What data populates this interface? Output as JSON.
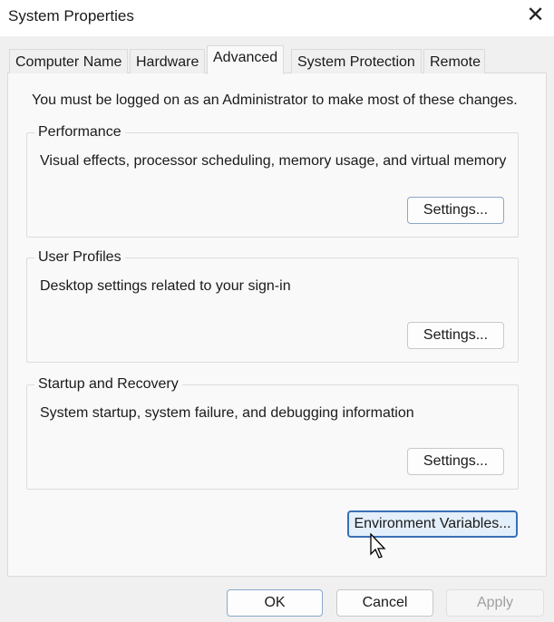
{
  "window": {
    "title": "System Properties",
    "close_icon": "close-icon"
  },
  "tabs": [
    {
      "label": "Computer Name"
    },
    {
      "label": "Hardware"
    },
    {
      "label": "Advanced",
      "active": true
    },
    {
      "label": "System Protection"
    },
    {
      "label": "Remote"
    }
  ],
  "panel": {
    "note": "You must be logged on as an Administrator to make most of these changes.",
    "groups": [
      {
        "label": "Performance",
        "description": "Visual effects, processor scheduling, memory usage, and virtual memory",
        "button": "Settings..."
      },
      {
        "label": "User Profiles",
        "description": "Desktop settings related to your sign-in",
        "button": "Settings..."
      },
      {
        "label": "Startup and Recovery",
        "description": "System startup, system failure, and debugging information",
        "button": "Settings..."
      }
    ],
    "env_button": "Environment Variables..."
  },
  "footer": {
    "ok": "OK",
    "cancel": "Cancel",
    "apply": "Apply"
  }
}
